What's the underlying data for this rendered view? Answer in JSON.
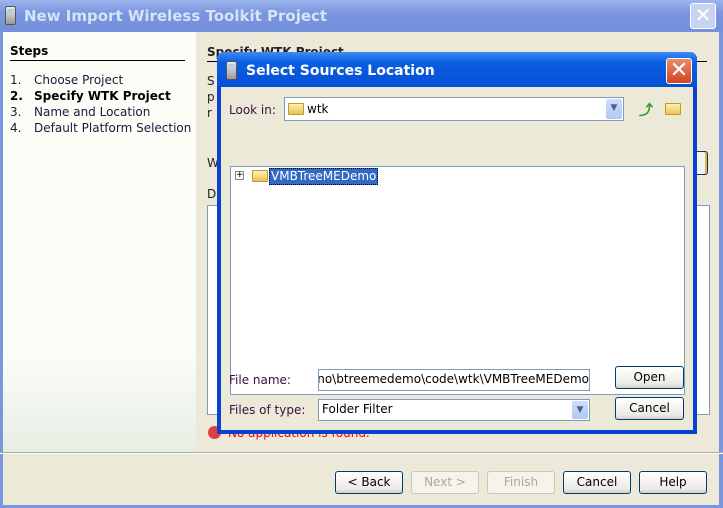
{
  "window": {
    "title": "New Import Wireless Toolkit Project",
    "close_icon": "close-icon"
  },
  "steps": {
    "title": "Steps",
    "items": [
      {
        "n": "1.",
        "label": "Choose Project"
      },
      {
        "n": "2.",
        "label": "Specify WTK Project"
      },
      {
        "n": "3.",
        "label": "Name and Location"
      },
      {
        "n": "4.",
        "label": "Default Platform Selection"
      }
    ]
  },
  "panel": {
    "title": "Specify WTK Project",
    "line1": "S",
    "line2": "p",
    "line3": "r",
    "label_w": "W",
    "label_d": "D",
    "error": "No application is found."
  },
  "footer": {
    "back": "< Back",
    "next": "Next >",
    "finish": "Finish",
    "cancel": "Cancel",
    "help": "Help"
  },
  "dialog": {
    "title": "Select Sources Location",
    "look_in_label": "Look in:",
    "look_in_value": "wtk",
    "tree": [
      {
        "label": "VMBTreeMEDemo",
        "selected": true
      }
    ],
    "file_name_label": "File name:",
    "file_name_value": "no\\btreemedemo\\code\\wtk\\VMBTreeMEDemo",
    "files_of_type_label": "Files of type:",
    "files_of_type_value": "Folder Filter",
    "open": "Open",
    "cancel": "Cancel"
  },
  "colors": {
    "dialog_title": "#0a5ee0",
    "selection": "#316ac5",
    "error": "#ff0000"
  }
}
